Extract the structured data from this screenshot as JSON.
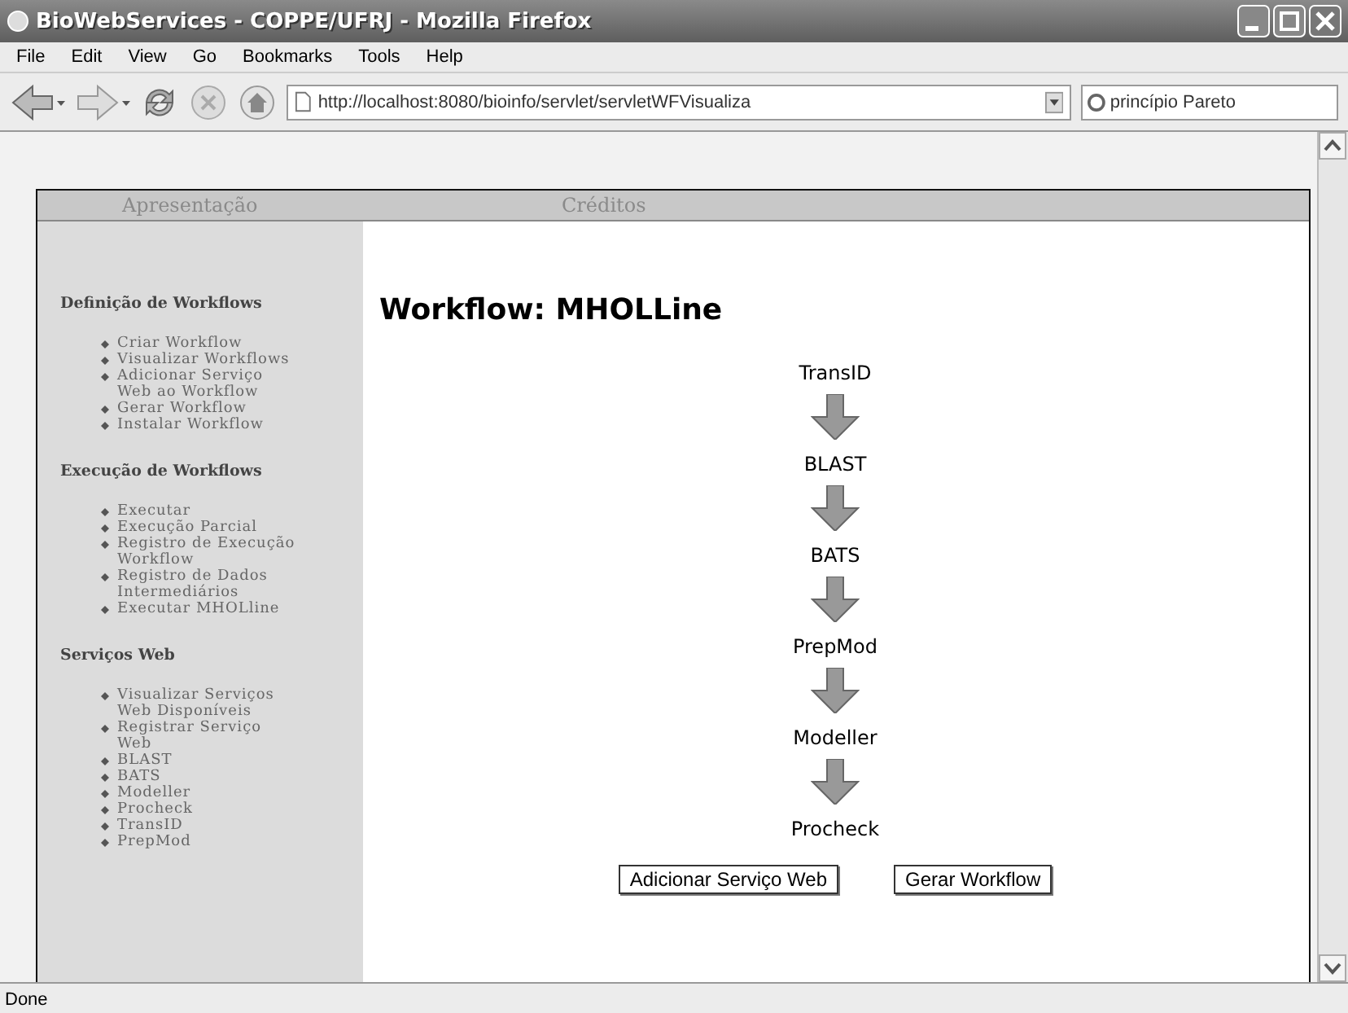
{
  "window": {
    "title": "BioWebServices - COPPE/UFRJ - Mozilla Firefox"
  },
  "menu": [
    "File",
    "Edit",
    "View",
    "Go",
    "Bookmarks",
    "Tools",
    "Help"
  ],
  "toolbar": {
    "url": "http://localhost:8080/bioinfo/servlet/servletWFVisualiza",
    "search": "princípio Pareto"
  },
  "page": {
    "nav": [
      "Apresentação",
      "Créditos"
    ],
    "sidebar": [
      {
        "heading": "Definição de Workflows",
        "items": [
          "Criar Workflow",
          "Visualizar Workflows",
          "Adicionar Serviço Web ao Workflow",
          "Gerar Workflow",
          "Instalar Workflow"
        ]
      },
      {
        "heading": "Execução de Workflows",
        "items": [
          "Executar",
          "Execução Parcial",
          "Registro de Execução Workflow",
          "Registro de Dados Intermediários",
          "Executar MHOLline"
        ]
      },
      {
        "heading": "Serviços Web",
        "items": [
          "Visualizar Serviços Web Disponíveis",
          "Registrar Serviço Web",
          "BLAST",
          "BATS",
          "Modeller",
          "Procheck",
          "TransID",
          "PrepMod"
        ]
      }
    ],
    "heading": "Workflow: MHOLLine",
    "workflow": [
      "TransID",
      "BLAST",
      "BATS",
      "PrepMod",
      "Modeller",
      "Procheck"
    ],
    "buttons": [
      "Adicionar Serviço Web",
      "Gerar Workflow"
    ]
  },
  "status_bar": "Done"
}
